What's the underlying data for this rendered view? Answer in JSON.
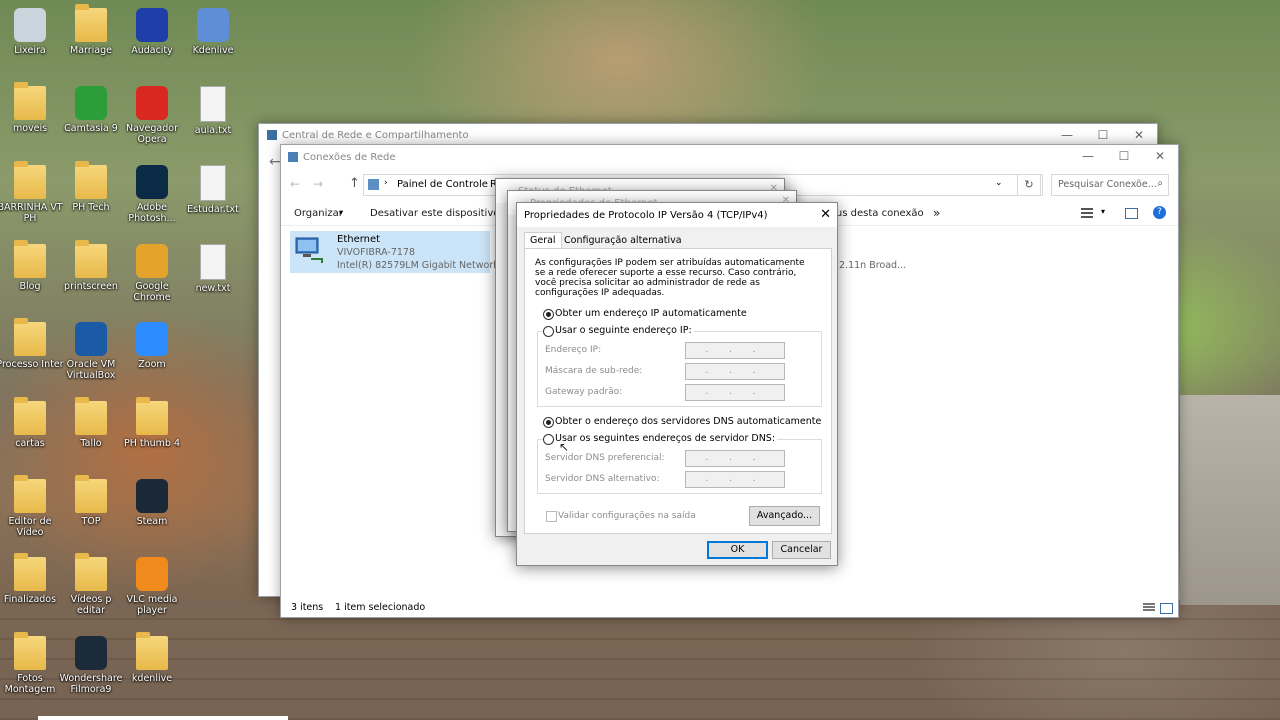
{
  "desktop": {
    "icons": [
      {
        "label": "Lixeira",
        "icon": "recycle-bin-icon"
      },
      {
        "label": "Marriage",
        "icon": "folder-icon"
      },
      {
        "label": "Audacity",
        "icon": "audacity-icon"
      },
      {
        "label": "Kdenlive",
        "icon": "kdenlive-icon"
      },
      {
        "label": "moveis",
        "icon": "folder-icon"
      },
      {
        "label": "Camtasia 9",
        "icon": "camtasia-icon"
      },
      {
        "label": "Navegador Opera",
        "icon": "opera-icon"
      },
      {
        "label": "aula.txt",
        "icon": "text-file-icon"
      },
      {
        "label": "BARRINHA VT PH",
        "icon": "folder-icon"
      },
      {
        "label": "PH Tech",
        "icon": "folder-icon"
      },
      {
        "label": "Adobe Photosh...",
        "icon": "photoshop-icon"
      },
      {
        "label": "Estudar.txt",
        "icon": "text-file-icon"
      },
      {
        "label": "Blog",
        "icon": "folder-icon"
      },
      {
        "label": "printscreen",
        "icon": "folder-icon"
      },
      {
        "label": "Google Chrome",
        "icon": "chrome-icon"
      },
      {
        "label": "new.txt",
        "icon": "text-file-icon"
      },
      {
        "label": "Processo Inter",
        "icon": "folder-icon"
      },
      {
        "label": "Oracle VM VirtualBox",
        "icon": "virtualbox-icon"
      },
      {
        "label": "Zoom",
        "icon": "zoom-icon"
      },
      {
        "label": "cartas",
        "icon": "folder-icon"
      },
      {
        "label": "Tallo",
        "icon": "folder-icon"
      },
      {
        "label": "PH thumb 4",
        "icon": "folder-icon"
      },
      {
        "label": "Editor de Vídeo",
        "icon": "folder-icon"
      },
      {
        "label": "TOP",
        "icon": "folder-icon"
      },
      {
        "label": "Steam",
        "icon": "steam-icon"
      },
      {
        "label": "Finalizados",
        "icon": "folder-icon"
      },
      {
        "label": "Vídeos p editar",
        "icon": "folder-icon"
      },
      {
        "label": "VLC media player",
        "icon": "vlc-icon"
      },
      {
        "label": "Fotos Montagem",
        "icon": "folder-icon"
      },
      {
        "label": "Wondershare Filmora9",
        "icon": "filmora-icon"
      },
      {
        "label": "kdenlive",
        "icon": "folder-icon"
      }
    ]
  },
  "back_window": {
    "title": "Central de Rede e Compartilhamento"
  },
  "explorer": {
    "title": "Conexões de Rede",
    "breadcrumb": "Painel de Controle",
    "breadcrumb_tail": "R",
    "search_placeholder": "Pesquisar Conexõe...",
    "toolbar": {
      "organize": "Organizar",
      "disable": "Desativar este dispositivo de r",
      "status": "tus desta conexão",
      "more": "»"
    },
    "item": {
      "name": "Ethernet",
      "network": "VIVOFIBRA-7178",
      "adapter": "Intel(R) 82579LM Gigabit Network..."
    },
    "wifi_partial": "2.11n Broad...",
    "statusbar": {
      "items": "3 itens",
      "selected": "1 item selecionado"
    }
  },
  "status_dialog": {
    "title": "Status de Ethernet",
    "title2": "Propriedades de Ethernet"
  },
  "ipv4_dialog": {
    "title": "Propriedades de Protocolo IP Versão 4 (TCP/IPv4)",
    "tabs": [
      "Geral",
      "Configuração alternativa"
    ],
    "description": "As configurações IP podem ser atribuídas automaticamente se a rede oferecer suporte a esse recurso. Caso contrário, você precisa solicitar ao administrador de rede as configurações IP adequadas.",
    "ip_auto": "Obter um endereço IP automaticamente",
    "ip_manual": "Usar o seguinte endereço IP:",
    "ip_address": "Endereço IP:",
    "subnet": "Máscara de sub-rede:",
    "gateway": "Gateway padrão:",
    "dns_auto": "Obter o endereço dos servidores DNS automaticamente",
    "dns_manual": "Usar os seguintes endereços de servidor DNS:",
    "dns_pref": "Servidor DNS preferencial:",
    "dns_alt": "Servidor DNS alternativo:",
    "validate": "Validar configurações na saída",
    "advanced": "Avançado...",
    "ok": "OK",
    "cancel": "Cancelar",
    "ip_placeholder": ". . .",
    "selected_ip": "auto",
    "selected_dns": "auto"
  }
}
